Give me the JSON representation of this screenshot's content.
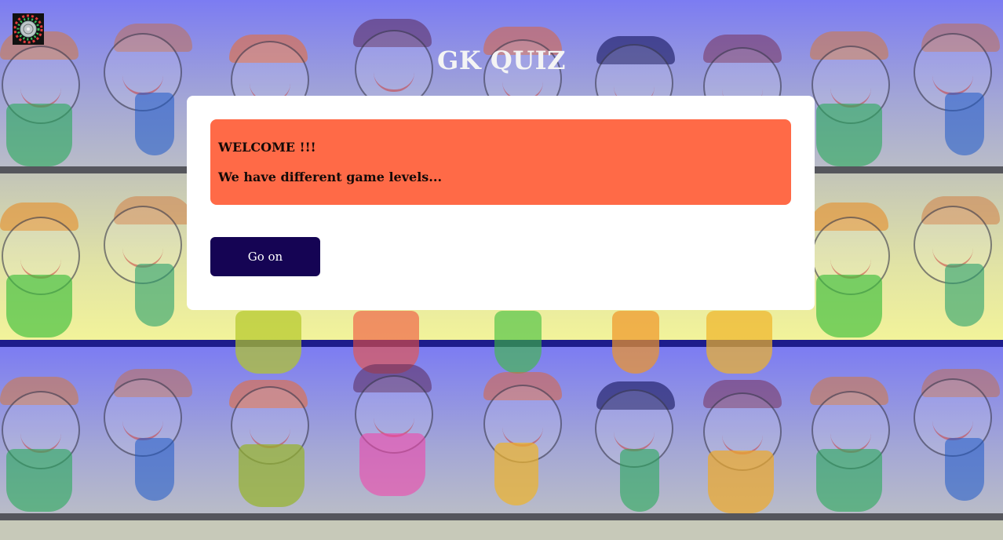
{
  "header": {
    "title": "GK QUIZ",
    "logo_icon": "roulette-wheel-icon"
  },
  "card": {
    "welcome_title": "WELCOME !!!",
    "welcome_message": "We have different game levels...",
    "go_button_label": "Go on"
  },
  "colors": {
    "welcome_box": "#ff6a47",
    "button": "#150454",
    "card": "#ffffff",
    "title": "#f4f4f4"
  }
}
